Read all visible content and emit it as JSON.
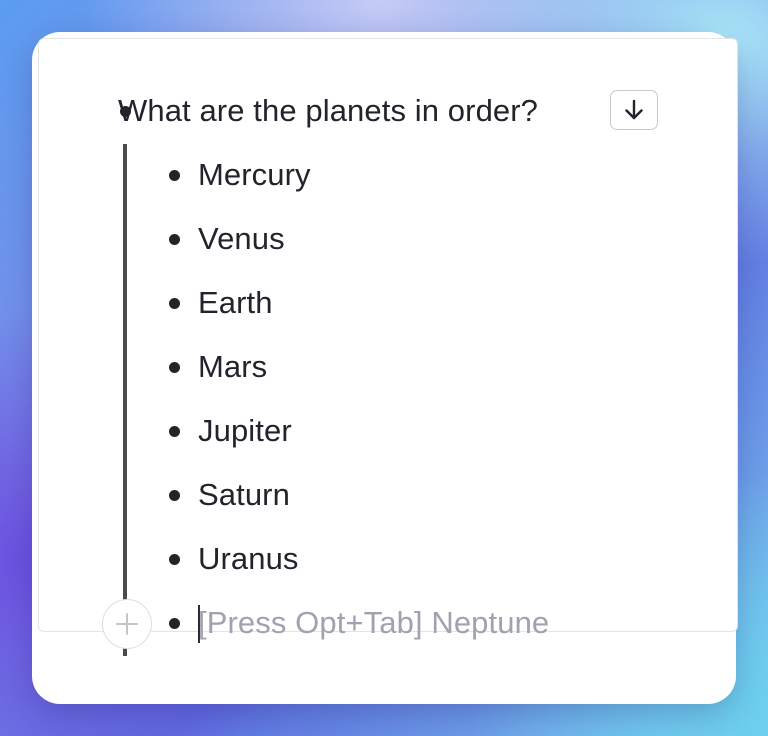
{
  "outline": {
    "question": "What are the planets in order?",
    "expand_button_icon": "arrow-down-icon",
    "items": [
      {
        "label": "Mercury"
      },
      {
        "label": "Venus"
      },
      {
        "label": "Earth"
      },
      {
        "label": "Mars"
      },
      {
        "label": "Jupiter"
      },
      {
        "label": "Saturn"
      },
      {
        "label": "Uranus"
      }
    ],
    "input_placeholder": "[Press Opt+Tab] Neptune",
    "add_button_icon": "plus-icon"
  },
  "colors": {
    "text": "#24232b",
    "placeholder": "#a1a1b0",
    "thread_line": "#4a4a4f"
  }
}
